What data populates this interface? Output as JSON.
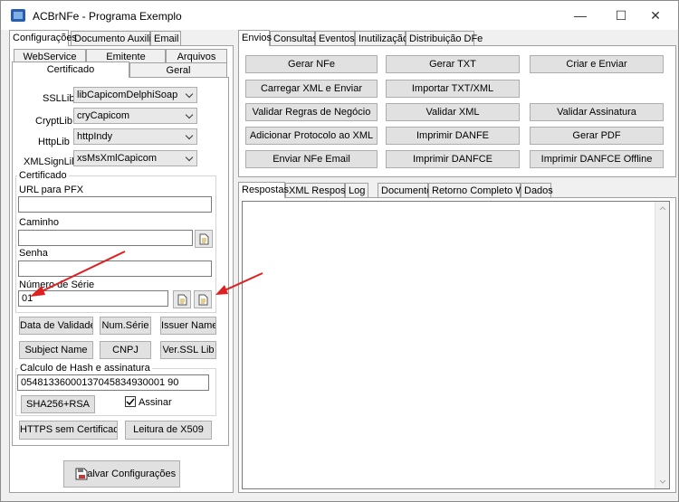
{
  "window": {
    "title": "ACBrNFe - Programa Exemplo",
    "min": "—",
    "max": "☐",
    "close": "✕"
  },
  "left": {
    "tabs": [
      "Configurações",
      "Documento Auxiliar",
      "Email"
    ],
    "subtabs_row1": [
      "WebService",
      "Emitente",
      "Arquivos"
    ],
    "subtabs_row2": [
      "Certificado",
      "Geral"
    ],
    "libs": [
      {
        "label": "SSLLib",
        "value": "libCapicomDelphiSoap"
      },
      {
        "label": "CryptLib",
        "value": "cryCapicom"
      },
      {
        "label": "HttpLib",
        "value": "httpIndy"
      },
      {
        "label": "XMLSignLib",
        "value": "xsMsXmlCapicom"
      }
    ],
    "cert": {
      "caption": "Certificado",
      "url_label": "URL para PFX",
      "url_value": "",
      "path_label": "Caminho",
      "path_value": "",
      "pass_label": "Senha",
      "pass_value": "",
      "serie_label": "Número de Série",
      "serie_value": "01"
    },
    "cert_buttons": [
      "Data de Validade",
      "Num.Série",
      "Issuer Name",
      "Subject Name",
      "CNPJ",
      "Ver.SSL Lib"
    ],
    "hash": {
      "caption": "Calculo de Hash e assinatura",
      "value": "05481336000137045834930001 90",
      "button": "SHA256+RSA",
      "check_label": "Assinar"
    },
    "bottom_buttons": [
      "HTTPS sem Certificado",
      "Leitura de X509"
    ],
    "save": "Salvar Configurações"
  },
  "right": {
    "tabs": [
      "Envios",
      "Consultas",
      "Eventos",
      "Inutilização",
      "Distribuição DFe"
    ],
    "buttons": [
      [
        "Gerar NFe",
        "Gerar TXT",
        "Criar e Enviar"
      ],
      [
        "Carregar XML e Enviar",
        "Importar TXT/XML",
        ""
      ],
      [
        "Validar Regras de Negócio",
        "Validar XML",
        "Validar Assinatura"
      ],
      [
        "Adicionar Protocolo ao XML",
        "Imprimir DANFE",
        "Gerar PDF"
      ],
      [
        "Enviar NFe Email",
        "Imprimir DANFCE",
        "Imprimir DANFCE Offline"
      ]
    ],
    "resp_tabs": [
      "Respostas",
      "XML Resposta",
      "Log",
      "Documento",
      "Retorno Completo WS",
      "Dados"
    ]
  }
}
